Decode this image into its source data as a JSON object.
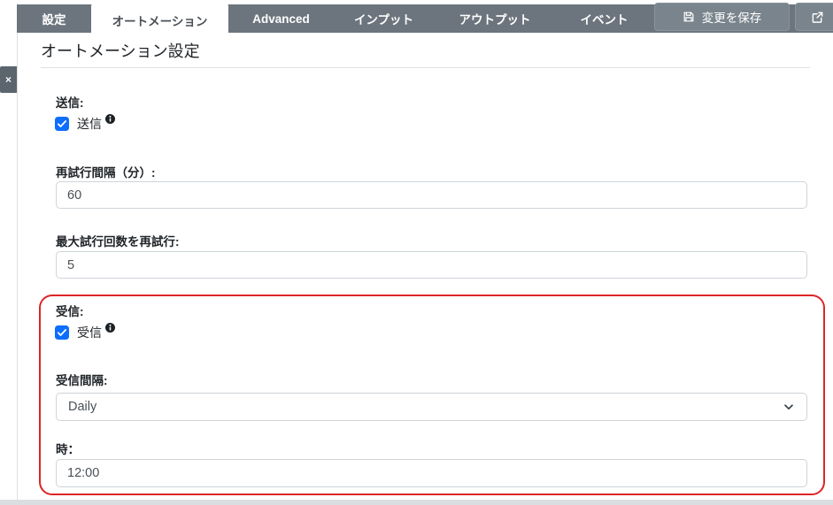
{
  "tabbar": {
    "tabs": [
      {
        "label": "設定"
      },
      {
        "label": "オートメーション"
      },
      {
        "label": "Advanced"
      },
      {
        "label": "インプット"
      },
      {
        "label": "アウトプット"
      },
      {
        "label": "イベント"
      }
    ],
    "active_tab": "オートメーション",
    "save_button_label": "変更を保存",
    "icons": {
      "save": "save-icon",
      "external": "box-arrow-up-right-icon"
    }
  },
  "sidebar": {
    "close_label": "×"
  },
  "page": {
    "title": "オートメーション設定"
  },
  "form": {
    "send": {
      "section_label": "送信:",
      "checkbox_label": "送信",
      "checked": true
    },
    "retry_interval": {
      "label": "再試行間隔（分）:",
      "value": "60"
    },
    "max_retries": {
      "label": "最大試行回数を再試行:",
      "value": "5"
    },
    "receive": {
      "section_label": "受信:",
      "checkbox_label": "受信",
      "checked": true,
      "interval_label": "受信間隔:",
      "interval_value": "Daily",
      "time_label": "時：",
      "time_value": "12:00"
    }
  },
  "colors": {
    "tabbar_bg": "#6c757d",
    "active_tab_text": "#495057",
    "checkbox_blue": "#0d6efd",
    "highlight_red": "#dc2626",
    "input_border": "#ced4da",
    "bottom_bar": "#dbdee1"
  }
}
